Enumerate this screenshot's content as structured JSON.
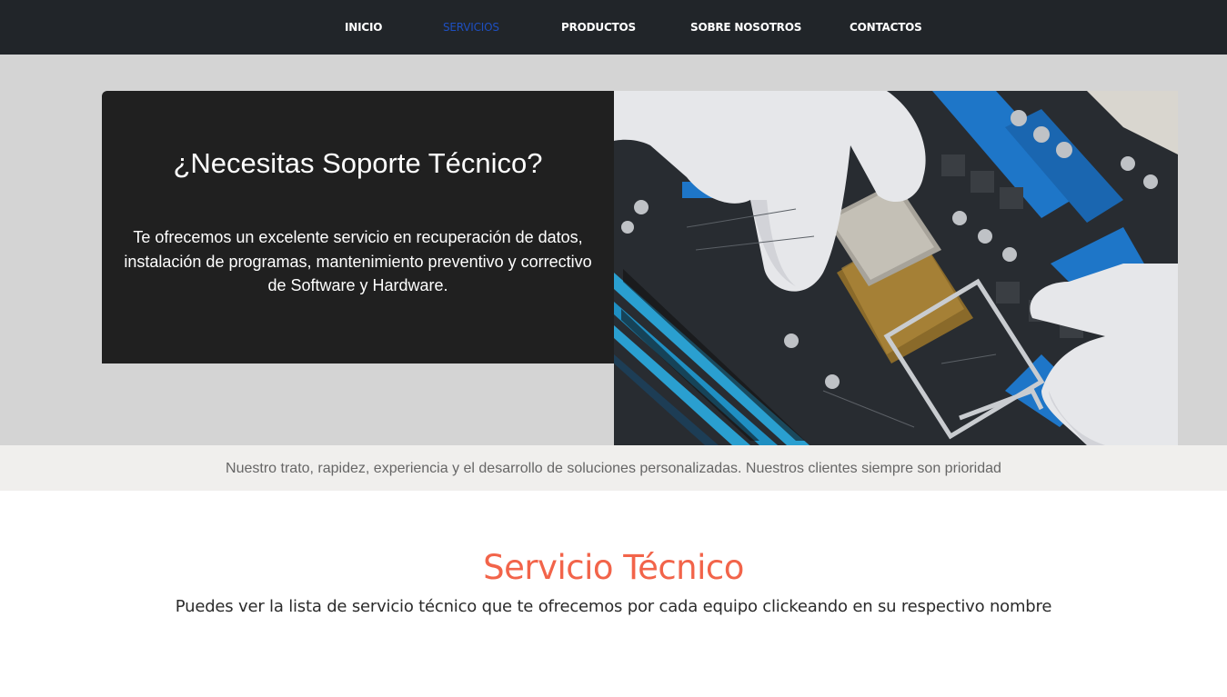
{
  "nav": {
    "items": [
      {
        "label": "INICIO"
      },
      {
        "label": "SERVICIOS",
        "active": true
      },
      {
        "label": "PRODUCTOS"
      },
      {
        "label": "SOBRE NOSOTROS"
      },
      {
        "label": "CONTACTOS"
      }
    ],
    "active_color": "#1e4fc0",
    "background": "#212529"
  },
  "hero": {
    "title": "¿Necesitas Soporte Técnico?",
    "text": "Te ofrecemos un excelente servicio en recuperación de datos, instalación de programas, mantenimiento preventivo y correctivo de Software y Hardware.",
    "image_icon": "motherboard-repair-photo"
  },
  "tagline": "Nuestro trato, rapidez, experiencia y el desarrollo de soluciones personalizadas. Nuestros clientes siempre son prioridad",
  "section": {
    "title": "Servicio Técnico",
    "subtitle": "Puedes ver la lista de servicio técnico que te ofrecemos por cada equipo clickeando en su respectivo nombre",
    "title_color": "#f2644a"
  }
}
